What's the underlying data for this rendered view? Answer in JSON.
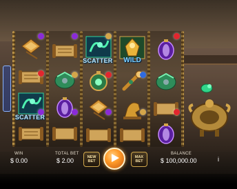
{
  "reel_grid": {
    "columns": 5,
    "rows": 4,
    "reel_1": [
      "parasol",
      "gold-scroll",
      "scatter-jade-dragon",
      "gold-scroll"
    ],
    "reel_2": [
      "gold-scroll",
      "jade-turtle",
      "purple-lantern",
      "gold-scroll"
    ],
    "reel_3": [
      "scatter-jade-dragon",
      "jade-amulet",
      "parasol",
      "gold-scroll"
    ],
    "reel_4": [
      "wild-jade-idol",
      "golden-ruyi",
      "golden-dragon-statue",
      "gold-scroll"
    ],
    "reel_5": [
      "purple-lantern",
      "jade-turtle",
      "gold-scroll",
      "purple-lantern"
    ],
    "right_feature": "golden-incense-burner"
  },
  "symbols": {
    "scatter_label": "SCATTER",
    "wild_label": "WILD"
  },
  "stats": {
    "win_label": "WIN",
    "win_value": "$ 0.00",
    "total_bet_label": "TOTAL BET",
    "total_bet_value": "$ 2.00",
    "balance_label": "BALANCE",
    "balance_value": "$ 100,000.00"
  },
  "buttons": {
    "new_bet_line1": "NEW",
    "new_bet_line2": "BET",
    "max_bet_line1": "MAX",
    "max_bet_line2": "BET",
    "info": "i"
  },
  "colors": {
    "gem_red": "#e2262e",
    "gem_purple": "#8a2bd8",
    "gem_blue": "#2f6be0",
    "gem_green": "#39d26a",
    "gold": "#d4a64a",
    "jade": "#31d48a",
    "spin_orange": "#ff9b2a"
  }
}
